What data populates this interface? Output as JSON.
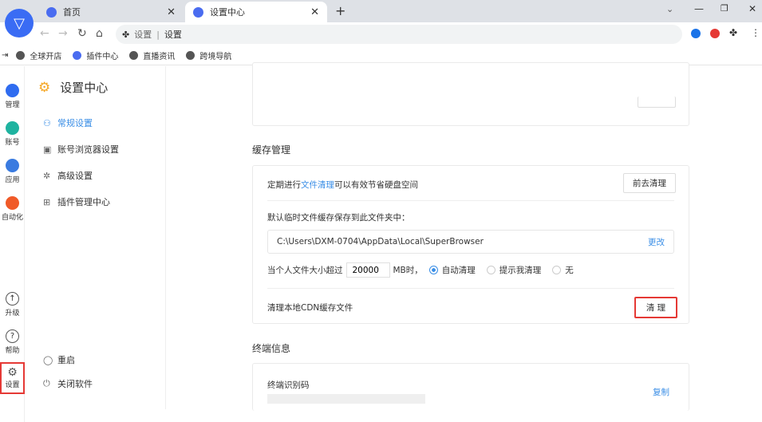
{
  "tabs": [
    {
      "label": "首页"
    },
    {
      "label": "设置中心"
    }
  ],
  "address": {
    "prefix": "设置",
    "text": "设置"
  },
  "bookmarks": [
    "全球开店",
    "插件中心",
    "直播资讯",
    "跨境导航"
  ],
  "rail": [
    {
      "label": "管理",
      "color": "#2f6cf0"
    },
    {
      "label": "账号",
      "color": "#1fb3a0"
    },
    {
      "label": "应用",
      "color": "#3a7be0"
    },
    {
      "label": "自动化",
      "color": "#f05a28"
    },
    {
      "label": "升级"
    },
    {
      "label": "帮助"
    },
    {
      "label": "设置"
    }
  ],
  "sidebar": {
    "title": "设置中心",
    "items": [
      "常规设置",
      "账号浏览器设置",
      "高级设置",
      "插件管理中心"
    ],
    "bottom": [
      "重启",
      "关闭软件"
    ]
  },
  "cache": {
    "heading": "缓存管理",
    "tip_prefix": "定期进行",
    "tip_link": "文件清理",
    "tip_suffix": "可以有效节省硬盘空间",
    "go_clean": "前去清理",
    "folder_label": "默认临时文件缓存保存到此文件夹中：",
    "path": "C:\\Users\\DXM-0704\\AppData\\Local\\SuperBrowser",
    "change": "更改",
    "size_prefix": "当个人文件大小超过",
    "size_value": "20000",
    "size_suffix": "MB时，",
    "options": [
      "自动清理",
      "提示我清理",
      "无"
    ],
    "cdn_label": "清理本地CDN缓存文件",
    "cdn_btn": "清 理"
  },
  "terminal": {
    "heading": "终端信息",
    "label": "终端识别码",
    "copy": "复制"
  },
  "accent": "#3a8ee6"
}
